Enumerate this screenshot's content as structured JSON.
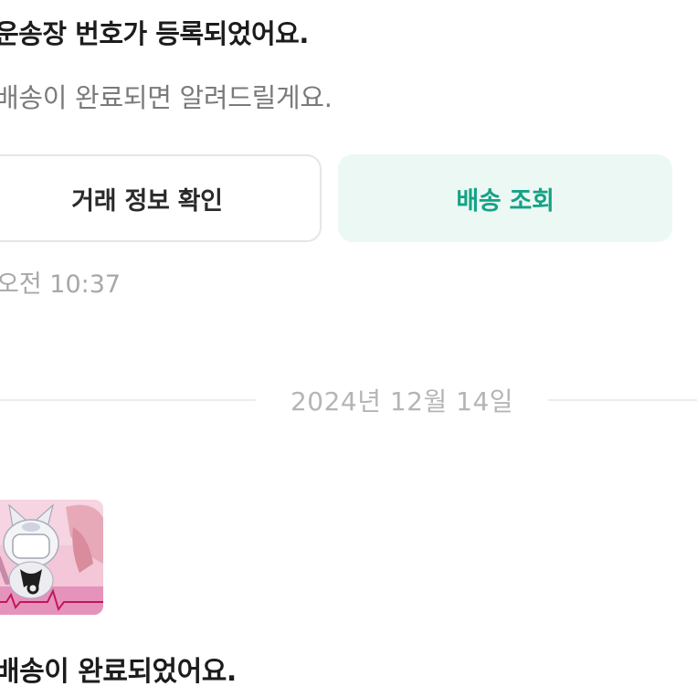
{
  "messages": {
    "tracking_registered": {
      "title": "운송장 번호가 등록되었어요.",
      "subtitle": "배송이 완료되면 알려드릴게요.",
      "buttons": {
        "detail_label": "거래 정보 확인",
        "track_label": "배송 조회"
      },
      "time": "오전 10:37"
    },
    "date_separator": "2024년 12월 14일",
    "delivered": {
      "title": "배송이 완료되었어요."
    }
  },
  "colors": {
    "accent_text": "#14a285",
    "accent_bg": "#ecf8f4",
    "muted_text": "#a8a8a8"
  }
}
